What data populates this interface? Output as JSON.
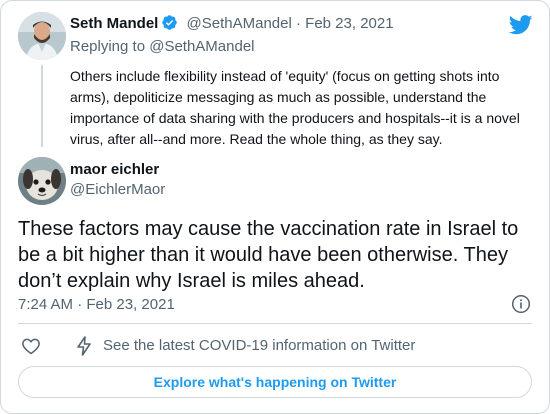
{
  "parent_tweet": {
    "author_name": "Seth Mandel",
    "handle": "@SethAMandel",
    "separator": "·",
    "date": "Feb 23, 2021",
    "reply_prefix": "Replying to",
    "reply_to": "@SethAMandel",
    "text": "Others include flexibility instead of 'equity' (focus on getting shots into arms), depoliticize messaging as much as possible, understand the importance of data sharing with the producers and hospitals--it is a novel virus, after all--and more. Read the whole thing, as they say.",
    "avatar_icon": "person-avatar",
    "verified_icon": "verified-badge-icon"
  },
  "main_tweet": {
    "author_name": "maor eichler",
    "handle": "@EichlerMaor",
    "text": "These factors may cause the vaccination rate in Israel to be a bit higher than it would have been otherwise. They don’t explain why Israel is miles ahead.",
    "time": "7:24 AM",
    "separator": "·",
    "date": "Feb 23, 2021",
    "avatar_icon": "dog-avatar"
  },
  "actions": {
    "like_icon": "heart-icon",
    "covid_icon": "lightning-bolt-icon",
    "covid_text": "See the latest COVID-19 information on Twitter",
    "explore_button": "Explore what's happening on Twitter"
  },
  "colors": {
    "brand_blue": "#1d9bf0",
    "text_primary": "#0f1419",
    "text_muted": "#536471",
    "border": "#cfd9de"
  }
}
